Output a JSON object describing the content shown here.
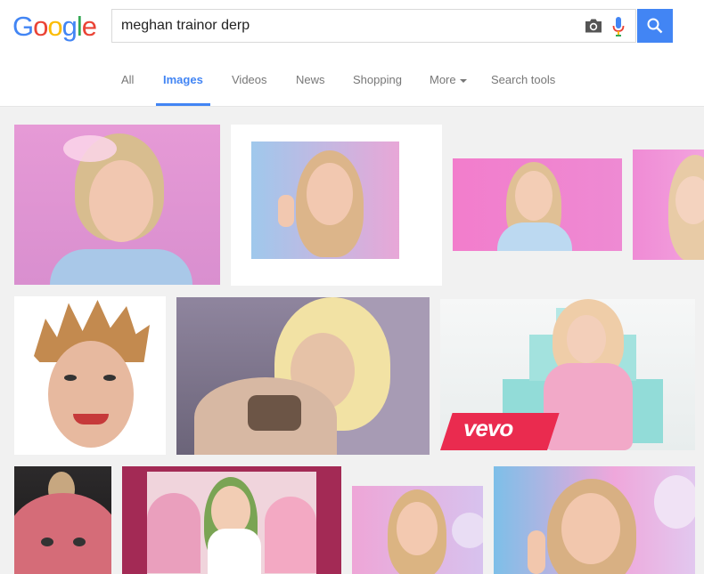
{
  "logo": {
    "letters": [
      "G",
      "o",
      "o",
      "g",
      "l",
      "e"
    ],
    "colors": [
      "#4285f4",
      "#ea4335",
      "#fbbc05",
      "#4285f4",
      "#34a853",
      "#ea4335"
    ]
  },
  "search": {
    "value": "meghan trainor derp"
  },
  "tabs": [
    {
      "label": "All"
    },
    {
      "label": "Images"
    },
    {
      "label": "Videos"
    },
    {
      "label": "News"
    },
    {
      "label": "Shopping"
    },
    {
      "label": "More"
    },
    {
      "label": "Search tools"
    }
  ],
  "colors": {
    "accent": "#4285f4"
  },
  "overlay": {
    "vevo": "vevo"
  }
}
